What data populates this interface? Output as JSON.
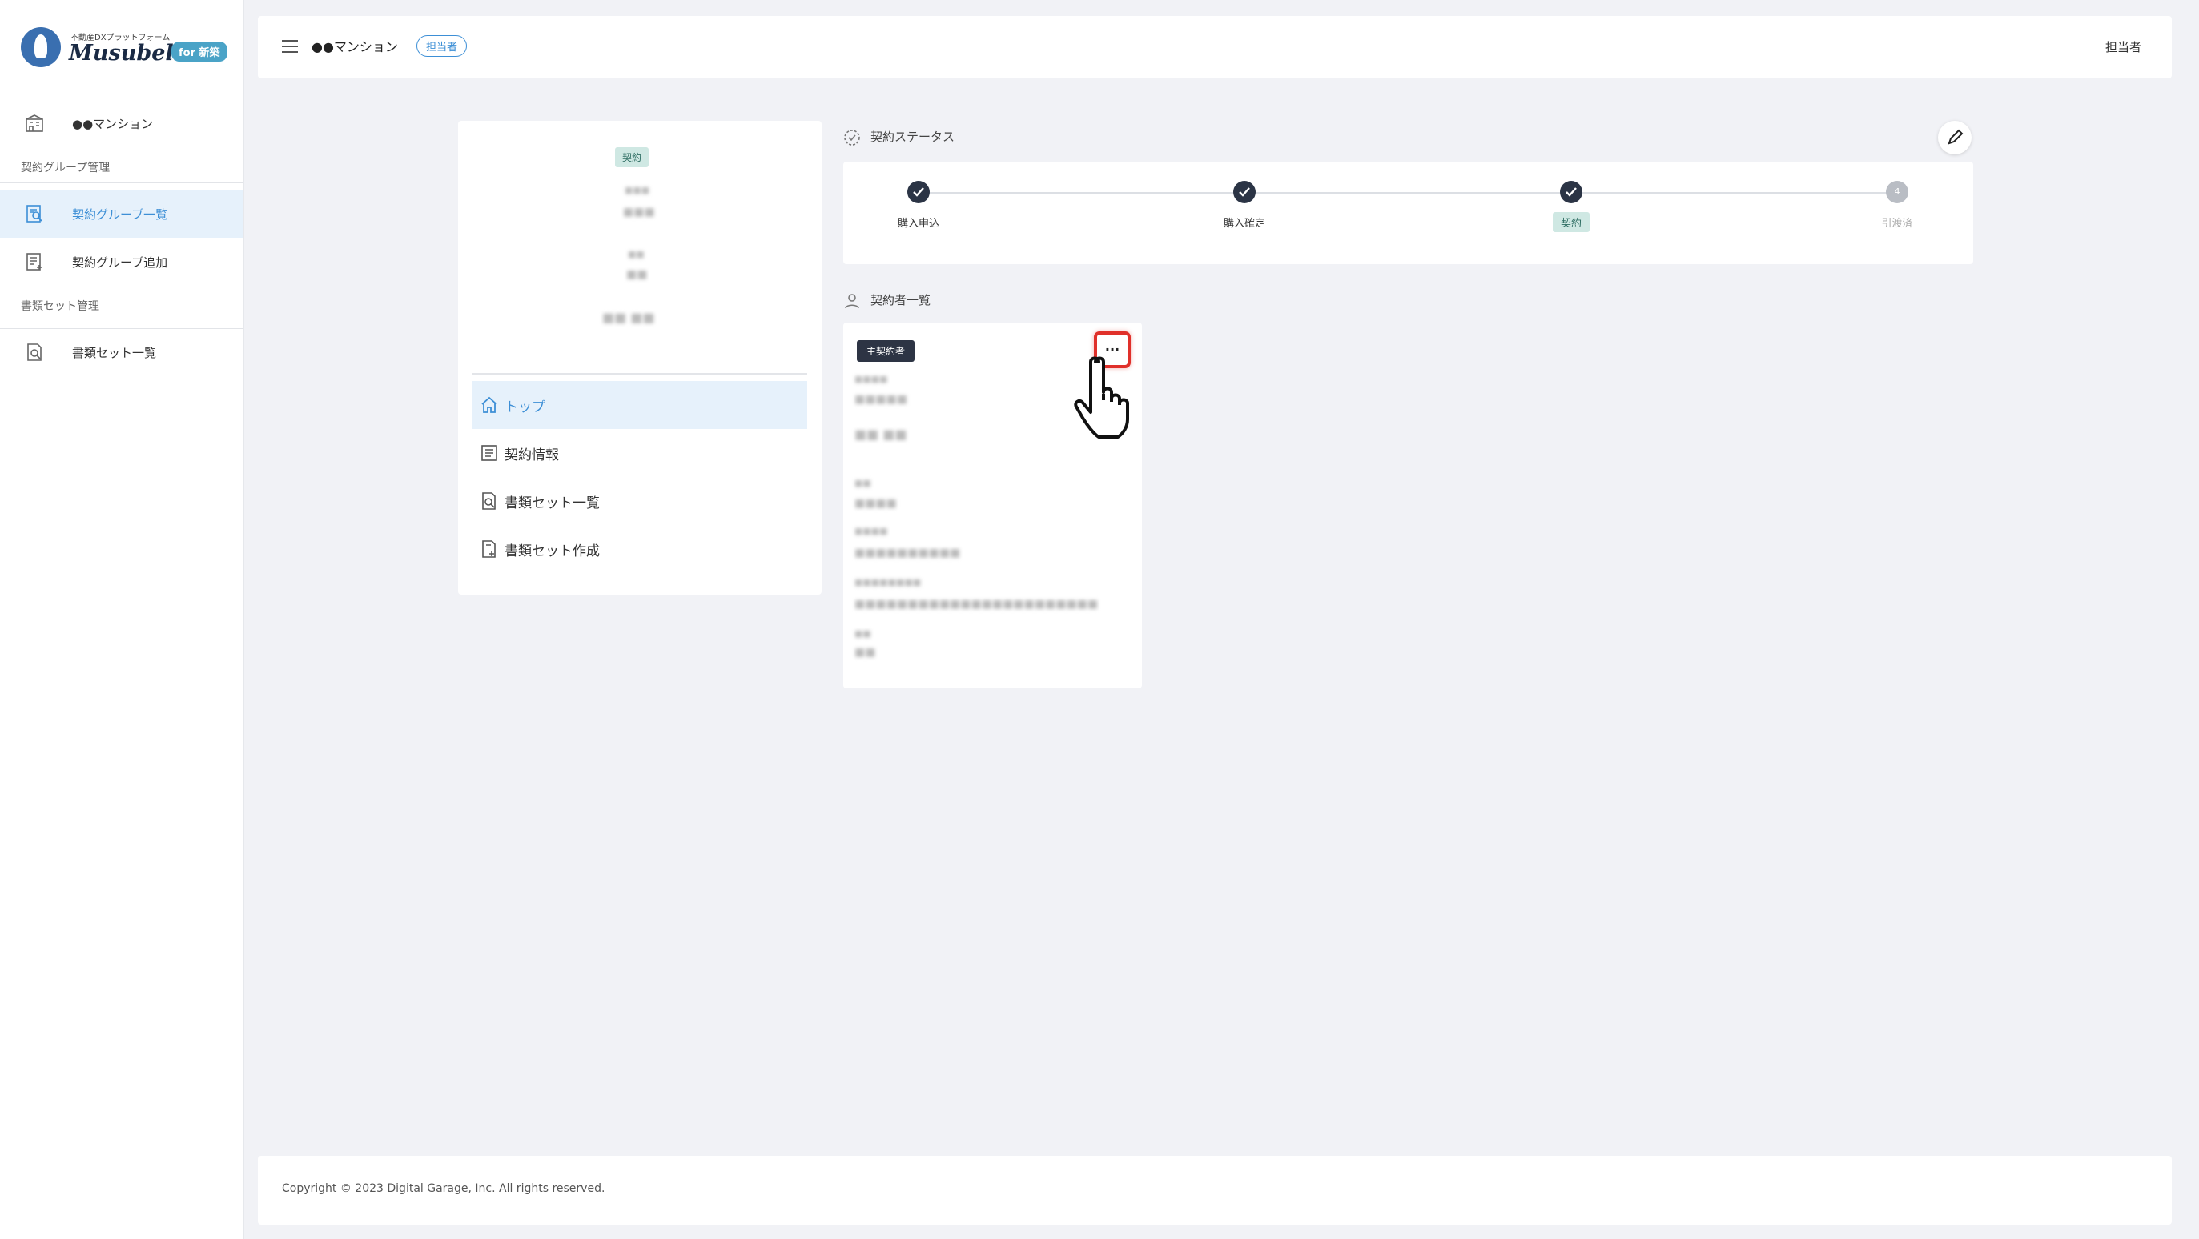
{
  "brand": {
    "tagline": "不動産DXプラットフォーム",
    "name": "Musubell",
    "badge": "for 新築"
  },
  "sidebar": {
    "property": "●●マンション",
    "section1": "契約グループ管理",
    "items1": [
      {
        "label": "契約グループ一覧"
      },
      {
        "label": "契約グループ追加"
      }
    ],
    "section2": "書類セット管理",
    "items2": [
      {
        "label": "書類セット一覧"
      }
    ]
  },
  "header": {
    "title": "●●マンション",
    "badge": "担当者",
    "user": "担当者"
  },
  "summary": {
    "status_pill": "契約",
    "menu": [
      {
        "label": "トップ"
      },
      {
        "label": "契約情報"
      },
      {
        "label": "書類セット一覧"
      },
      {
        "label": "書類セット作成"
      }
    ]
  },
  "contract_status": {
    "title": "契約ステータス",
    "steps": [
      {
        "label": "購入申込",
        "state": "done"
      },
      {
        "label": "購入確定",
        "state": "done"
      },
      {
        "label": "契約",
        "state": "current"
      },
      {
        "label": "引渡済",
        "state": "todo",
        "index": "4"
      }
    ]
  },
  "contractors": {
    "title": "契約者一覧",
    "role_badge": "主契約者",
    "menu_button": "..."
  },
  "footer": {
    "copyright": "Copyright © 2023 Digital Garage, Inc. All rights reserved."
  },
  "colors": {
    "accent": "#3d8fd6",
    "highlight": "#e0302a",
    "step_done": "#2b3445"
  }
}
